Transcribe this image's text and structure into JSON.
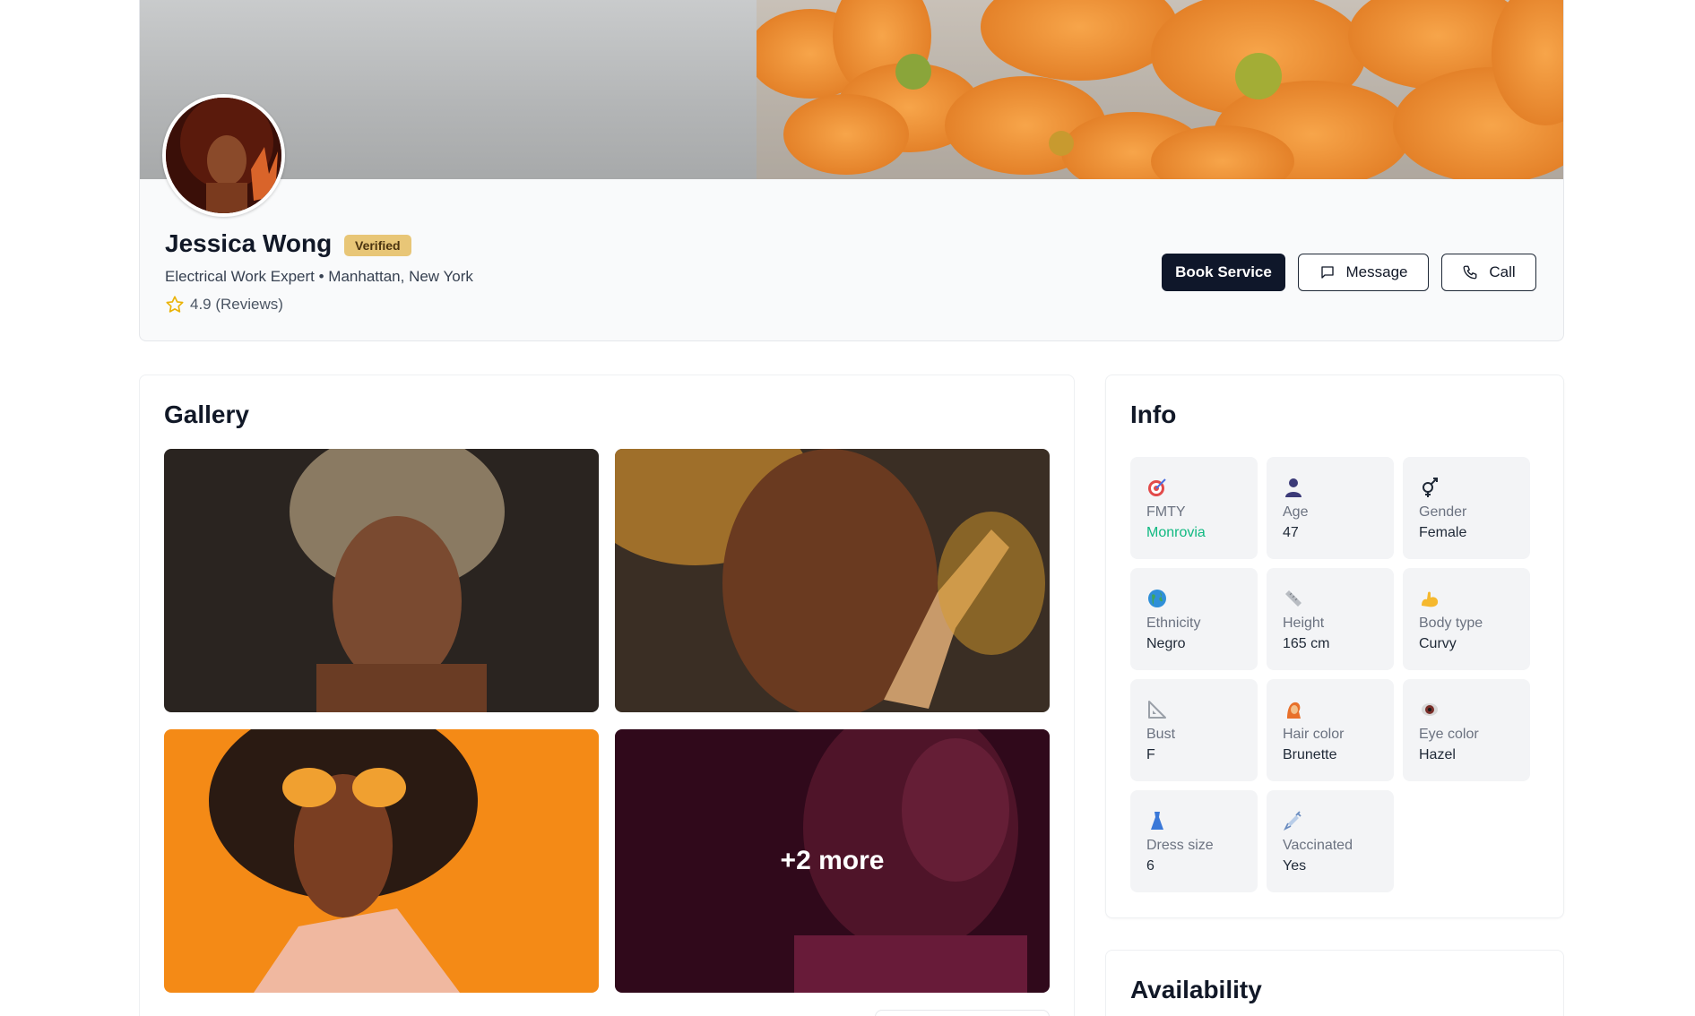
{
  "profile": {
    "name": "Jessica Wong",
    "verified_label": "Verified",
    "subtitle": "Electrical Work Expert • Manhattan, New York",
    "rating_text": "4.9 (Reviews)",
    "actions": {
      "book": "Book Service",
      "message": "Message",
      "call": "Call"
    }
  },
  "gallery": {
    "title": "Gallery",
    "more_label": "+2 more"
  },
  "info": {
    "title": "Info",
    "items": [
      {
        "label": "FMTY",
        "value": "Monrovia",
        "icon": "target-icon"
      },
      {
        "label": "Age",
        "value": "47",
        "icon": "person-icon"
      },
      {
        "label": "Gender",
        "value": "Female",
        "icon": "gender-icon"
      },
      {
        "label": "Ethnicity",
        "value": "Negro",
        "icon": "globe-icon"
      },
      {
        "label": "Height",
        "value": "165 cm",
        "icon": "ruler-icon"
      },
      {
        "label": "Body type",
        "value": "Curvy",
        "icon": "flexed-arm-icon"
      },
      {
        "label": "Bust",
        "value": "F",
        "icon": "triangle-ruler-icon"
      },
      {
        "label": "Hair color",
        "value": "Brunette",
        "icon": "hair-icon"
      },
      {
        "label": "Eye color",
        "value": "Hazel",
        "icon": "eye-icon"
      },
      {
        "label": "Dress size",
        "value": "6",
        "icon": "dress-icon"
      },
      {
        "label": "Vaccinated",
        "value": "Yes",
        "icon": "syringe-icon"
      }
    ]
  },
  "availability": {
    "title": "Availability"
  },
  "colors": {
    "primary_button": "#0f172a",
    "verified_badge": "#e8c677",
    "accent_value": "#10b981",
    "star": "#eab308"
  }
}
